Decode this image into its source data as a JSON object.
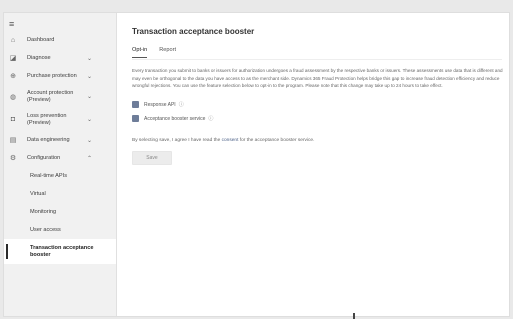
{
  "sidebar": {
    "menu_icon": "hamburger-icon",
    "items": [
      {
        "label": "Dashboard",
        "icon": "home-icon"
      },
      {
        "label": "Diagnose",
        "icon": "diagnose-icon"
      },
      {
        "label": "Purchase protection",
        "icon": "shield-icon"
      },
      {
        "label": "Account protection (Preview)",
        "icon": "account-icon"
      },
      {
        "label": "Loss prevention (Preview)",
        "icon": "loss-icon"
      },
      {
        "label": "Data engineering",
        "icon": "data-icon"
      },
      {
        "label": "Configuration",
        "icon": "gear-icon"
      },
      {
        "label": "Real-time APIs"
      },
      {
        "label": "Virtual"
      },
      {
        "label": "Monitoring"
      },
      {
        "label": "User access"
      },
      {
        "label": "Transaction acceptance booster"
      }
    ]
  },
  "main": {
    "title": "Transaction acceptance booster",
    "tabs": [
      "Opt-in",
      "Report"
    ],
    "description": "Every transaction you submit to banks or issuers for authorization undergoes a fraud assessment by the respective banks or issuers. These assessments use data that is different and may even be orthogonal to the data you have access to as the merchant side. Dynamics 365 Fraud Protection helps bridge this gap to increase fraud detection efficiency and reduce wrongful rejections. You can use the feature selection below to opt-in to the program. Please note that this change may take up to 24 hours to take effect.",
    "checkboxes": [
      {
        "label": "Response API",
        "checked": true
      },
      {
        "label": "Acceptance booster service",
        "checked": true
      }
    ],
    "consent_prefix": "By selecting save, I agree I have read the ",
    "consent_link": "consent",
    "consent_suffix": " for the acceptance booster service.",
    "save_label": "Save"
  },
  "colors": {
    "checkbox": "#6e7d99",
    "link": "#4a5f86",
    "sidebar_bg": "#f1f1f1"
  }
}
